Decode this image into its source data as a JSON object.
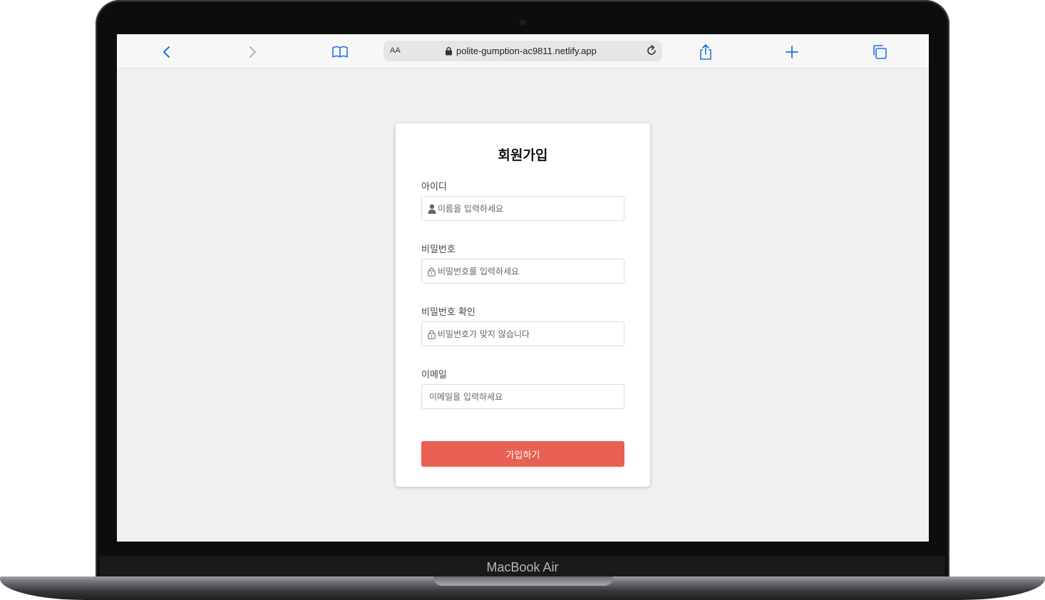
{
  "device": {
    "brand": "MacBook Air"
  },
  "browser": {
    "reader_label": "AA",
    "url": "polite-gumption-ac9811.netlify.app",
    "accent": "#1a73e8",
    "icons": [
      "back-icon",
      "forward-icon",
      "bookmarks-icon",
      "lock-icon",
      "reload-icon",
      "share-icon",
      "new-tab-icon",
      "tabs-icon"
    ]
  },
  "form": {
    "title": "회원가입",
    "fields": [
      {
        "label": "아이디",
        "placeholder": "이름을 입력하세요",
        "icon": "user-icon"
      },
      {
        "label": "비밀번호",
        "placeholder": "비밀번호를 입력하세요",
        "icon": "lock-icon"
      },
      {
        "label": "비밀번호 확인",
        "placeholder": "비밀번호가 맞지 않습니다",
        "icon": "lock-icon"
      },
      {
        "label": "이메일",
        "placeholder": "이메일을 입력하세요",
        "icon": ""
      }
    ],
    "submit_label": "가입하기",
    "submit_color": "#e96055"
  }
}
